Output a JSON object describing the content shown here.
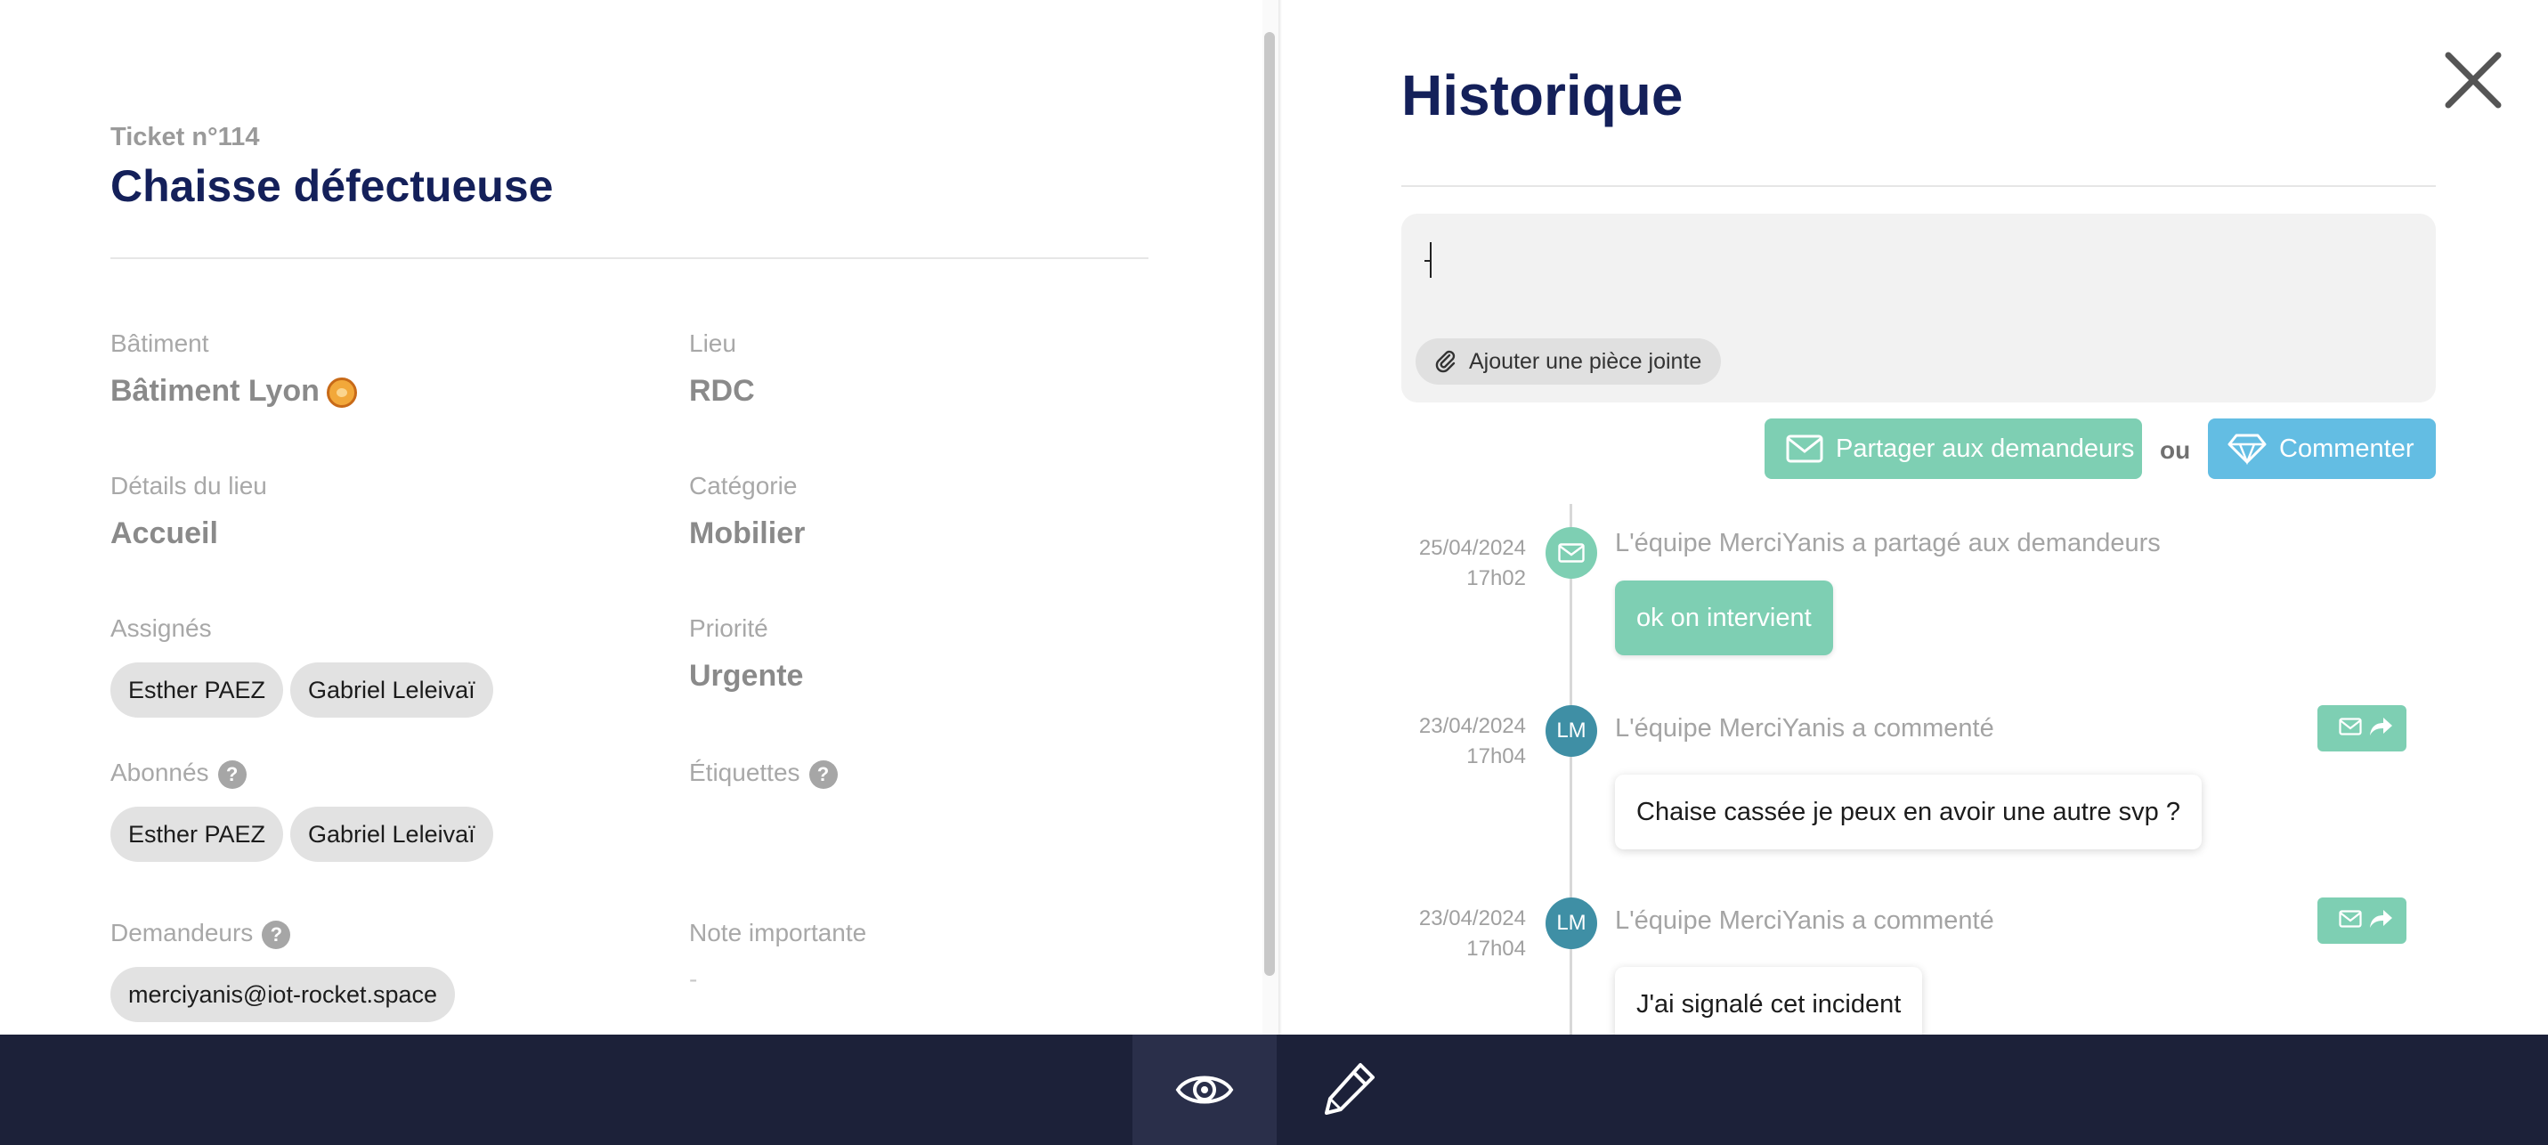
{
  "ticket": {
    "number": "Ticket n°114",
    "title": "Chaisse défectueuse"
  },
  "fields": {
    "building": {
      "label": "Bâtiment",
      "value": "Bâtiment Lyon"
    },
    "location": {
      "label": "Lieu",
      "value": "RDC"
    },
    "location_details": {
      "label": "Détails du lieu",
      "value": "Accueil"
    },
    "category": {
      "label": "Catégorie",
      "value": "Mobilier"
    },
    "assignees": {
      "label": "Assignés",
      "items": [
        "Esther PAEZ",
        "Gabriel Leleivaï"
      ]
    },
    "priority": {
      "label": "Priorité",
      "value": "Urgente"
    },
    "subscribers": {
      "label": "Abonnés",
      "items": [
        "Esther PAEZ",
        "Gabriel Leleivaï"
      ]
    },
    "tags": {
      "label": "Étiquettes"
    },
    "requesters": {
      "label": "Demandeurs",
      "items": [
        "merciyanis@iot-rocket.space"
      ]
    },
    "important_note": {
      "label": "Note importante",
      "value": "-"
    },
    "help_glyph": "?"
  },
  "history": {
    "title": "Historique",
    "composer": {
      "value": "",
      "attach_label": "Ajouter une pièce jointe"
    },
    "share_label": "Partager aux demandeurs",
    "or_label": "ou",
    "comment_label": "Commenter",
    "entries": [
      {
        "date": "25/04/2024",
        "time": "17h02",
        "author": "L'équipe MerciYanis a partagé aux demandeurs",
        "message": "ok on intervient",
        "kind": "share"
      },
      {
        "date": "23/04/2024",
        "time": "17h04",
        "avatar": "LM",
        "author": "L'équipe MerciYanis a commenté",
        "message": "Chaise cassée je peux en avoir une autre svp ?",
        "kind": "comment"
      },
      {
        "date": "23/04/2024",
        "time": "17h04",
        "avatar": "LM",
        "author": "L'équipe MerciYanis a commenté",
        "message": "J'ai signalé cet incident",
        "kind": "comment"
      }
    ]
  },
  "colors": {
    "title_navy": "#14205a",
    "share_green": "#7ecfb3",
    "comment_blue": "#63bde3",
    "avatar_teal": "#3f8fa5",
    "bottom_bar": "#1c2139"
  },
  "icons": {
    "close": "close-icon",
    "paperclip": "paperclip-icon",
    "envelope": "envelope-icon",
    "diamond": "diamond-icon",
    "share_arrow": "share-arrow-icon",
    "eye": "eye-icon",
    "pencil": "pencil-icon",
    "lion_emoji": "lion-face-icon"
  }
}
